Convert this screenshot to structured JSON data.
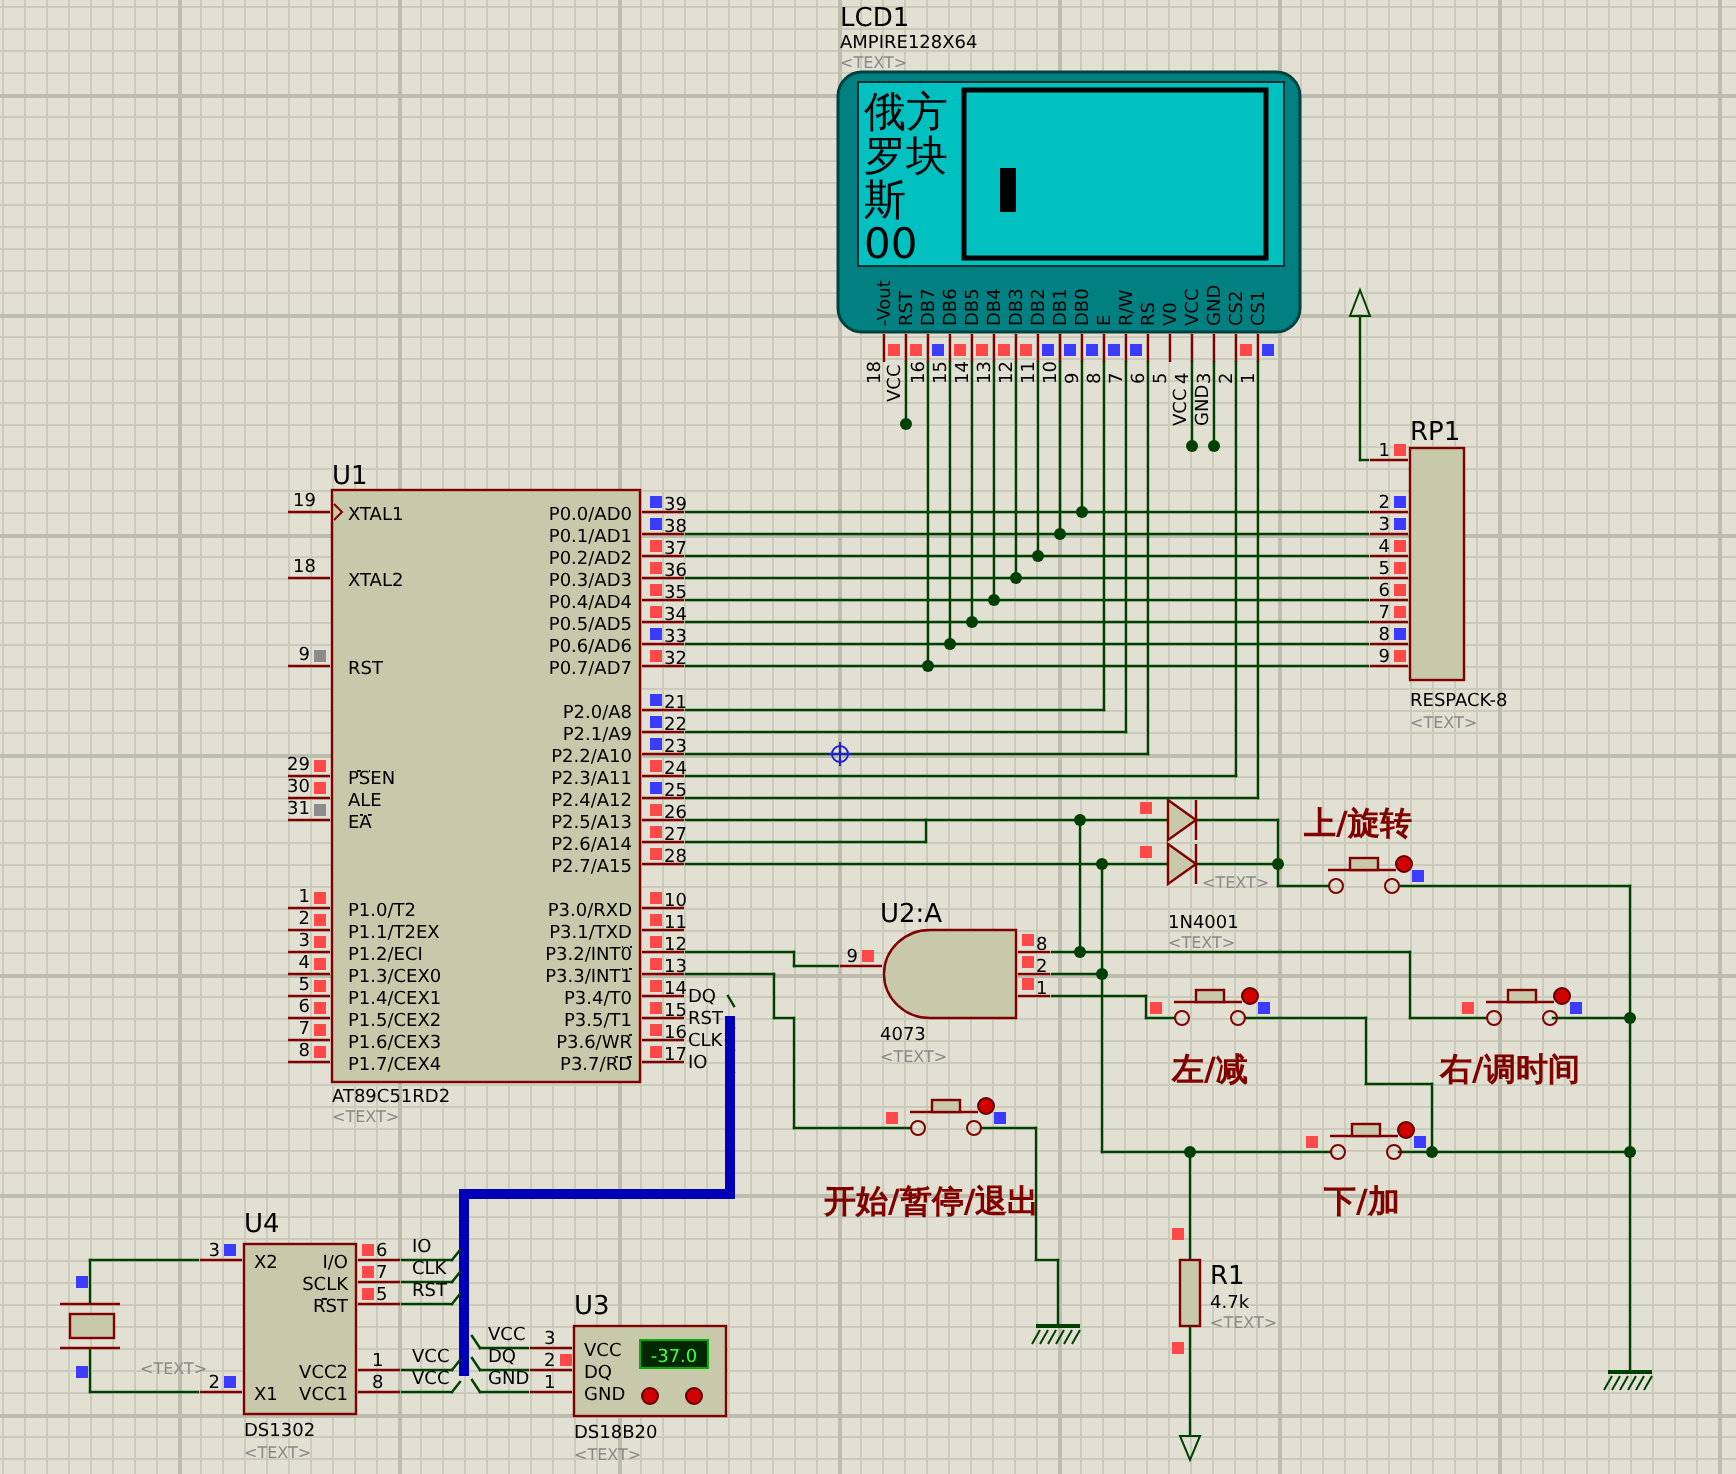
{
  "lcd": {
    "ref": "LCD1",
    "part": "AMPIRE128X64",
    "text": "<TEXT>",
    "screen_lines": [
      "俄方",
      "罗块",
      "斯",
      "00"
    ],
    "pins": [
      {
        "label": "-Vout",
        "number": "18",
        "color": "#ff4848"
      },
      {
        "label": "RST",
        "net": "VCC",
        "color": "#ff4848"
      },
      {
        "label": "DB7",
        "number": "16",
        "color": "#3c3cff"
      },
      {
        "label": "DB6",
        "number": "15",
        "color": "#ff4848"
      },
      {
        "label": "DB5",
        "number": "14",
        "color": "#ff4848"
      },
      {
        "label": "DB4",
        "number": "13",
        "color": "#ff4848"
      },
      {
        "label": "DB3",
        "number": "12",
        "color": "#ff4848"
      },
      {
        "label": "DB2",
        "number": "11",
        "color": "#3c3cff"
      },
      {
        "label": "DB1",
        "number": "10",
        "color": "#3c3cff"
      },
      {
        "label": "DB0",
        "number": "9",
        "color": "#3c3cff"
      },
      {
        "label": "E",
        "number": "8",
        "color": "#3c3cff"
      },
      {
        "label": "R/W",
        "number": "7",
        "color": "#3c3cff"
      },
      {
        "label": "RS",
        "number": "6"
      },
      {
        "label": "V0",
        "number": "5"
      },
      {
        "label": "VCC",
        "number": "4",
        "net": "VCC"
      },
      {
        "label": "GND",
        "number": "3",
        "net": "GND"
      },
      {
        "label": "CS2",
        "number": "2",
        "color": "#ff4848"
      },
      {
        "label": "CS1",
        "number": "1",
        "color": "#3c3cff"
      }
    ]
  },
  "mcu": {
    "ref": "U1",
    "part": "AT89C51RD2",
    "text": "<TEXT>",
    "left_pins": [
      {
        "number": "19",
        "name": "XTAL1",
        "clock": true
      },
      {
        "number": "18",
        "name": "XTAL2"
      },
      {
        "number": "9",
        "name": "RST",
        "color": "#8c8c8c"
      },
      {
        "number": "29",
        "bar": "PSEN",
        "color": "#ff4848"
      },
      {
        "number": "30",
        "name": "ALE",
        "color": "#ff4848"
      },
      {
        "number": "31",
        "bar": "EA",
        "color": "#8c8c8c"
      },
      {
        "number": "1",
        "name": "P1.0/T2",
        "color": "#ff4848"
      },
      {
        "number": "2",
        "name": "P1.1/T2EX",
        "color": "#ff4848"
      },
      {
        "number": "3",
        "name": "P1.2/ECI",
        "color": "#ff4848"
      },
      {
        "number": "4",
        "name": "P1.3/CEX0",
        "color": "#ff4848"
      },
      {
        "number": "5",
        "name": "P1.4/CEX1",
        "color": "#ff4848"
      },
      {
        "number": "6",
        "name": "P1.5/CEX2",
        "color": "#ff4848"
      },
      {
        "number": "7",
        "name": "P1.6/CEX3",
        "color": "#ff4848"
      },
      {
        "number": "8",
        "name": "P1.7/CEX4",
        "color": "#ff4848"
      }
    ],
    "right_pins": [
      {
        "number": "39",
        "name": "P0.0/AD0",
        "color": "#3c3cff"
      },
      {
        "number": "38",
        "name": "P0.1/AD1",
        "color": "#3c3cff"
      },
      {
        "number": "37",
        "name": "P0.2/AD2",
        "color": "#ff4848"
      },
      {
        "number": "36",
        "name": "P0.3/AD3",
        "color": "#ff4848"
      },
      {
        "number": "35",
        "name": "P0.4/AD4",
        "color": "#ff4848"
      },
      {
        "number": "34",
        "name": "P0.5/AD5",
        "color": "#ff4848"
      },
      {
        "number": "33",
        "name": "P0.6/AD6",
        "color": "#3c3cff"
      },
      {
        "number": "32",
        "name": "P0.7/AD7",
        "color": "#ff4848"
      },
      {
        "number": "21",
        "name": "P2.0/A8",
        "color": "#3c3cff"
      },
      {
        "number": "22",
        "name": "P2.1/A9",
        "color": "#3c3cff"
      },
      {
        "number": "23",
        "name": "P2.2/A10",
        "color": "#3c3cff"
      },
      {
        "number": "24",
        "name": "P2.3/A11",
        "color": "#ff4848"
      },
      {
        "number": "25",
        "name": "P2.4/A12",
        "color": "#3c3cff"
      },
      {
        "number": "26",
        "name": "P2.5/A13",
        "color": "#ff4848"
      },
      {
        "number": "27",
        "name": "P2.6/A14",
        "color": "#ff4848"
      },
      {
        "number": "28",
        "name": "P2.7/A15",
        "color": "#ff4848"
      },
      {
        "number": "10",
        "name": "P3.0/RXD",
        "color": "#ff4848"
      },
      {
        "number": "11",
        "name": "P3.1/TXD",
        "color": "#ff4848"
      },
      {
        "number": "12",
        "name": "P3.2/",
        "bar": "INT0",
        "color": "#ff4848"
      },
      {
        "number": "13",
        "name": "P3.3/",
        "bar": "INT1",
        "color": "#ff4848"
      },
      {
        "number": "14",
        "name": "P3.4/T0",
        "color": "#ff4848",
        "net": "DQ"
      },
      {
        "number": "15",
        "name": "P3.5/T1",
        "color": "#ff4848",
        "net": "RST"
      },
      {
        "number": "16",
        "name": "P3.6/",
        "bar": "WR",
        "color": "#ff4848",
        "net": "CLK"
      },
      {
        "number": "17",
        "name": "P3.7/",
        "bar": "RD",
        "color": "#ff4848",
        "net": "IO"
      }
    ]
  },
  "respack": {
    "ref": "RP1",
    "part": "RESPACK-8",
    "text": "<TEXT>",
    "pins": [
      {
        "number": "1",
        "color": "#ff4848"
      },
      {
        "number": "2",
        "color": "#3c3cff"
      },
      {
        "number": "3",
        "color": "#3c3cff"
      },
      {
        "number": "4",
        "color": "#ff4848"
      },
      {
        "number": "5",
        "color": "#ff4848"
      },
      {
        "number": "6",
        "color": "#ff4848"
      },
      {
        "number": "7",
        "color": "#ff4848"
      },
      {
        "number": "8",
        "color": "#3c3cff"
      },
      {
        "number": "9",
        "color": "#ff4848"
      }
    ]
  },
  "diode": {
    "part": "1N4001",
    "texts": [
      "<TEXT>",
      "<TEXT>"
    ],
    "pins": [
      {
        "color": "#ff4848"
      },
      {
        "color": "#ff4848"
      }
    ]
  },
  "gate": {
    "ref": "U2:A",
    "part": "4073",
    "text": "<TEXT>",
    "pins": [
      {
        "number": "9",
        "color": "#ff4848"
      },
      {
        "number": "8",
        "color": "#ff4848"
      },
      {
        "number": "2",
        "color": "#ff4848"
      },
      {
        "number": "1",
        "color": "#ff4848"
      }
    ]
  },
  "buttons": [
    {
      "caption": "上/旋转",
      "right_pin": {
        "color": "#3c3cff"
      }
    },
    {
      "caption": "左/减",
      "left_pin": {
        "color": "#ff4848"
      },
      "right_pin": {
        "color": "#3c3cff"
      }
    },
    {
      "caption": "右/调时间",
      "left_pin": {
        "color": "#ff4848"
      },
      "right_pin": {
        "color": "#3c3cff"
      }
    },
    {
      "caption": "下/加",
      "left_pin": {
        "color": "#ff4848"
      },
      "right_pin": {
        "color": "#3c3cff"
      }
    },
    {
      "caption": "开始/暂停/退出",
      "left_pin": {
        "color": "#ff4848"
      },
      "right_pin": {
        "color": "#3c3cff"
      }
    }
  ],
  "rtc": {
    "ref": "U4",
    "part": "DS1302",
    "text": "<TEXT>",
    "pins": [
      {
        "number": "3",
        "name": "X2",
        "color": "#3c3cff"
      },
      {
        "number": "2",
        "name": "X1",
        "color": "#3c3cff"
      },
      {
        "number": "6",
        "name": "I/O",
        "color": "#ff4848",
        "net": "IO"
      },
      {
        "number": "7",
        "name": "SCLK",
        "color": "#ff4848",
        "net": "CLK"
      },
      {
        "number": "5",
        "bar": "RST",
        "color": "#ff4848",
        "net": "RST"
      },
      {
        "number": "1",
        "name": "VCC2",
        "net": "VCC"
      },
      {
        "number": "8",
        "name": "VCC1",
        "net": "VCC"
      }
    ],
    "crystal": {
      "text": "<TEXT>",
      "pins": [
        {
          "color": "#3c3cff"
        },
        {
          "color": "#3c3cff"
        }
      ]
    }
  },
  "sensor": {
    "ref": "U3",
    "part": "DS18B20",
    "text": "<TEXT>",
    "reading": "-37.0",
    "pins": [
      {
        "number": "3",
        "name": "VCC",
        "net": "VCC"
      },
      {
        "number": "2",
        "name": "DQ",
        "color": "#ff4848",
        "net": "DQ"
      },
      {
        "number": "1",
        "name": "GND",
        "net": "GND"
      }
    ]
  },
  "resistor": {
    "ref": "R1",
    "value": "4.7k",
    "text": "<TEXT>",
    "pins": [
      {
        "color": "#ff4848"
      },
      {
        "color": "#ff4848"
      }
    ]
  }
}
